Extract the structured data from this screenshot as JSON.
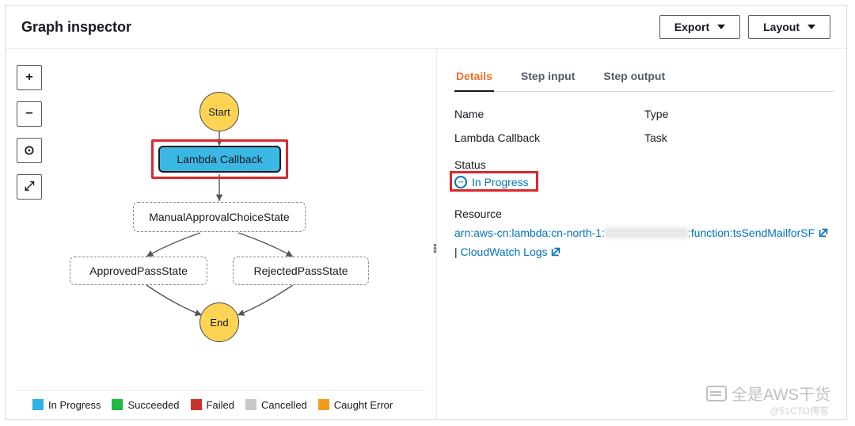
{
  "header": {
    "title": "Graph inspector",
    "export_label": "Export",
    "layout_label": "Layout"
  },
  "toolbar": {
    "zoom_in": "+",
    "zoom_out": "−",
    "center": "⊙",
    "fullscreen": "⤢"
  },
  "graph": {
    "start": "Start",
    "lambda": "Lambda Callback",
    "choice": "ManualApprovalChoiceState",
    "approved": "ApprovedPassState",
    "rejected": "RejectedPassState",
    "end": "End"
  },
  "legend": {
    "in_progress": "In Progress",
    "succeeded": "Succeeded",
    "failed": "Failed",
    "cancelled": "Cancelled",
    "caught_error": "Caught Error"
  },
  "tabs": {
    "details": "Details",
    "step_input": "Step input",
    "step_output": "Step output"
  },
  "details": {
    "name_label": "Name",
    "name_value": "Lambda Callback",
    "type_label": "Type",
    "type_value": "Task",
    "status_label": "Status",
    "status_value": "In Progress",
    "resource_label": "Resource",
    "resource_prefix": "arn:aws-cn:lambda:cn-north-1:",
    "resource_suffix": ":function:tsSendMailforSF",
    "cw_label": "CloudWatch Logs"
  },
  "watermark": {
    "main": "全是AWS干货",
    "sub": "@51CTO博客"
  }
}
